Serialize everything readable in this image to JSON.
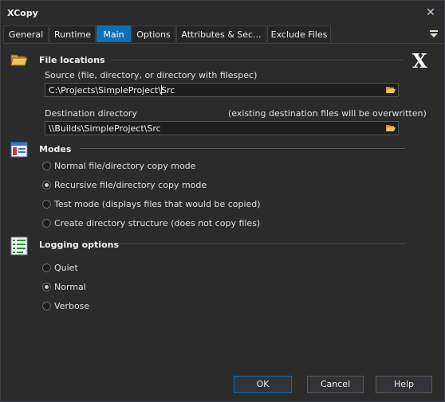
{
  "window": {
    "title": "XCopy"
  },
  "tabs": [
    {
      "label": "General"
    },
    {
      "label": "Runtime"
    },
    {
      "label": "Main",
      "active": true
    },
    {
      "label": "Options"
    },
    {
      "label": "Attributes & Sec..."
    },
    {
      "label": "Exclude Files"
    }
  ],
  "file_locations": {
    "title": "File locations",
    "source_label": "Source (file, directory, or directory with filespec)",
    "source_value": "C:\\Projects\\SimpleProject\\Src",
    "destination_label": "Destination directory",
    "destination_note": "(existing destination files will be overwritten)",
    "destination_value": "\\\\Builds\\SimpleProject\\Src"
  },
  "modes": {
    "title": "Modes",
    "options": [
      {
        "label": "Normal file/directory copy mode",
        "checked": false
      },
      {
        "label": "Recursive file/directory copy mode",
        "checked": true
      },
      {
        "label": "Test mode (displays files that would be copied)",
        "checked": false
      },
      {
        "label": "Create directory structure (does not copy files)",
        "checked": false
      }
    ]
  },
  "logging": {
    "title": "Logging options",
    "options": [
      {
        "label": "Quiet",
        "checked": false
      },
      {
        "label": "Normal",
        "checked": true
      },
      {
        "label": "Verbose",
        "checked": false
      }
    ]
  },
  "buttons": {
    "ok": "OK",
    "cancel": "Cancel",
    "help": "Help"
  },
  "colors": {
    "accent": "#0e6fb8",
    "background": "#2b2b2b"
  }
}
